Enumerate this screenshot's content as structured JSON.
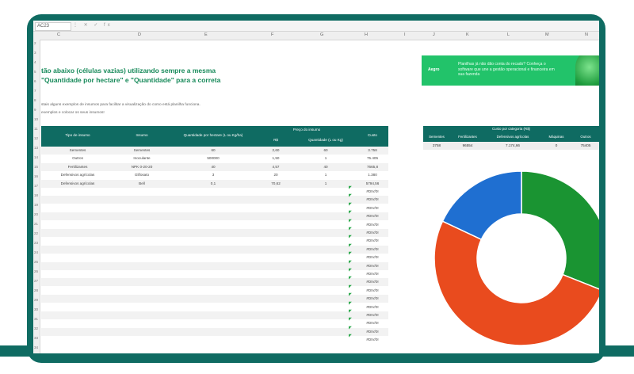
{
  "formula_bar": {
    "cell_name": "AC23",
    "icons": "⋮ ✕ ✓ fx"
  },
  "columns": [
    "C",
    "D",
    "E",
    "F",
    "G",
    "H",
    "I",
    "J",
    "K",
    "L",
    "M",
    "N"
  ],
  "rows": [
    "2",
    "3",
    "4",
    "5",
    "6",
    "7",
    "8",
    "9",
    "10",
    "11",
    "12",
    "13",
    "14",
    "15",
    "16",
    "17",
    "18",
    "19",
    "20",
    "21",
    "22",
    "23",
    "24",
    "25",
    "26",
    "27",
    "28",
    "29",
    "30",
    "31",
    "32",
    "33",
    "34"
  ],
  "sheet": {
    "title_line1": "tão abaixo (células vazias) utilizando sempre a mesma",
    "title_line2": "\"Quantidade por hectare\" e \"Quantidade\" para a correta",
    "note_line1": "stais alguns exemplos de insumos para facilitar a visualização do como está planilha funciona.",
    "note_line2": "exemplos e colocar os seus insumos!"
  },
  "banner": {
    "logo": "Aegro",
    "text": "Planilhas já não dão conta do recado? Conheça o software que une a gestão operacional e financeira em sua fazenda"
  },
  "table": {
    "headers": {
      "tipo": "Tipo de insumo",
      "insumo": "Insumo",
      "qtd_hectare": "Quantidade por hectare (L ou Kg/ha)",
      "preco_group": "Preço do insumo",
      "preco_rs": "R$",
      "preco_qtd": "Quantidade (L ou Kg)",
      "custo": "Custo"
    },
    "rows": [
      {
        "tipo": "Sementes",
        "insumo": "Sementes",
        "qtd": "60",
        "rs": "2,60",
        "q": "60",
        "custo": "3.758"
      },
      {
        "tipo": "Outros",
        "insumo": "Inoculante",
        "qtd": "500000",
        "rs": "1,50",
        "q": "1",
        "custo": "75.405"
      },
      {
        "tipo": "Fertilizantes",
        "insumo": "NPK 0-20-20",
        "qtd": "40",
        "rs": "4,57",
        "q": "40",
        "custo": "7665,8"
      },
      {
        "tipo": "Defensivos agrícolas",
        "insumo": "Glifosato",
        "qtd": "3",
        "rs": "20",
        "q": "1",
        "custo": "1.380"
      },
      {
        "tipo": "Defensivos agrícolas",
        "insumo": "Bell",
        "qtd": "0,1",
        "rs": "70,62",
        "q": "1",
        "custo": "5794,56"
      }
    ],
    "error_value": "#DIV/0!"
  },
  "cost_summary": {
    "title": "Custo por categoria (R$)",
    "headers": [
      "Sementes",
      "Fertilizantes",
      "Defensivos agrícolas",
      "Máquinas",
      "Outros"
    ],
    "values": [
      "3758",
      "96554",
      "7.174,66",
      "0",
      "75405"
    ]
  },
  "colors": {
    "teal": "#0f6b62",
    "green": "#1a9432",
    "red": "#e94b1e",
    "blue": "#1f6fd1",
    "banner": "#22c36a"
  },
  "chart_data": {
    "type": "pie",
    "title": "",
    "labels": [],
    "values": [
      31,
      51,
      18
    ],
    "colors": [
      "#1a9432",
      "#e94b1e",
      "#1f6fd1"
    ],
    "donut": true
  }
}
